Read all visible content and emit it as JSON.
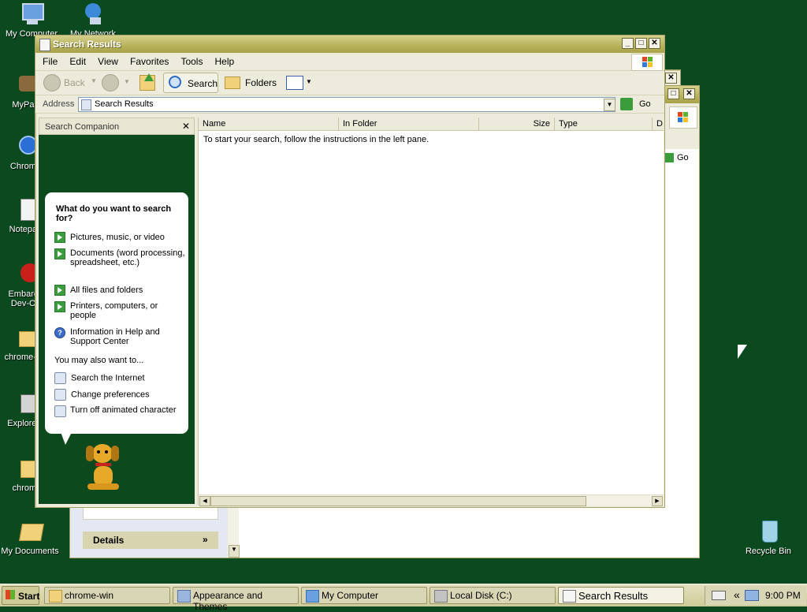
{
  "desktop": {
    "icons": [
      {
        "label": "My Computer"
      },
      {
        "label": "My Network Places"
      },
      {
        "label": "MyPa..."
      },
      {
        "label": "Chrom..."
      },
      {
        "label": "Notepa..."
      },
      {
        "label": "Embarc... Dev-C..."
      },
      {
        "label": "chrome-w..."
      },
      {
        "label": "Explorer..."
      },
      {
        "label": "chrome"
      },
      {
        "label": "My Documents"
      },
      {
        "label": "Recycle Bin"
      }
    ]
  },
  "back_window": {
    "go_label": "Go",
    "details_label": "Details"
  },
  "search_window": {
    "title": "Search Results",
    "menu": [
      "File",
      "Edit",
      "View",
      "Favorites",
      "Tools",
      "Help"
    ],
    "toolbar": {
      "back": "Back",
      "search": "Search",
      "folders": "Folders"
    },
    "address": {
      "label": "Address",
      "value": "Search Results",
      "go": "Go"
    },
    "companion": {
      "title": "Search Companion",
      "close": "✕",
      "question": "What do you want to search for?",
      "options": [
        "Pictures, music, or video",
        "Documents (word processing, spreadsheet, etc.)",
        "All files and folders",
        "Printers, computers, or people",
        "Information in Help and Support Center"
      ],
      "also_label": "You may also want to...",
      "also": [
        "Search the Internet",
        "Change preferences",
        "Turn off animated character"
      ]
    },
    "columns": [
      "Name",
      "In Folder",
      "Size",
      "Type",
      "D"
    ],
    "empty_message": "To start your search, follow the instructions in the left pane."
  },
  "taskbar": {
    "start": "Start",
    "buttons": [
      "chrome-win",
      "Appearance and Themes",
      "My Computer",
      "Local Disk (C:)",
      "Search Results"
    ],
    "tray_chevron": "«",
    "clock": "9:00 PM"
  },
  "colors": {
    "desktop": "#0b4a1f",
    "title": "#b7b25b",
    "companion_bg": "#0c4a1e",
    "arrow": "#3a9c3a"
  }
}
